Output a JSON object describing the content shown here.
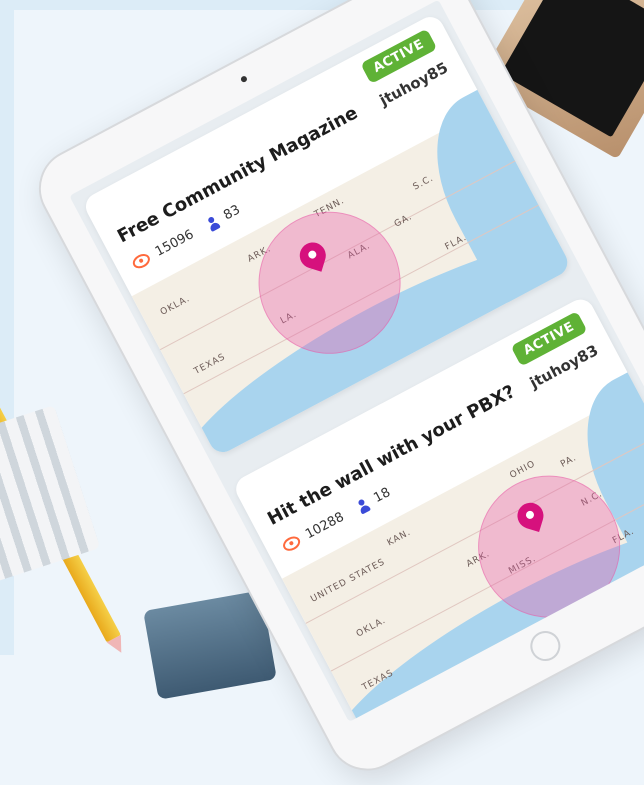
{
  "cards": [
    {
      "badge": "ACTIVE",
      "author": "jtuhoy85",
      "title": "Free Community Magazine",
      "views": "15096",
      "users": "83"
    },
    {
      "badge": "ACTIVE",
      "author": "jtuhoy83",
      "title": "Hit the wall with your PBX?",
      "views": "10288",
      "users": "18"
    }
  ],
  "map_labels": {
    "okla": "OKLA.",
    "ark": "ARK.",
    "tenn": "TENN.",
    "texas": "TEXAS",
    "la": "LA.",
    "ala": "ALA.",
    "ga": "GA.",
    "fla": "FLA.",
    "sc": "S.C.",
    "nc": "N.C.",
    "united_states": "UNITED STATES",
    "kan": "KAN.",
    "miss": "MISS.",
    "ohio": "OHIO",
    "pa": "PA."
  },
  "colors": {
    "active_badge": "#5fb236",
    "pin": "#d6117d",
    "circle": "#e958a7",
    "views_icon": "#ff6a3d",
    "users_icon": "#3b4bd8"
  }
}
